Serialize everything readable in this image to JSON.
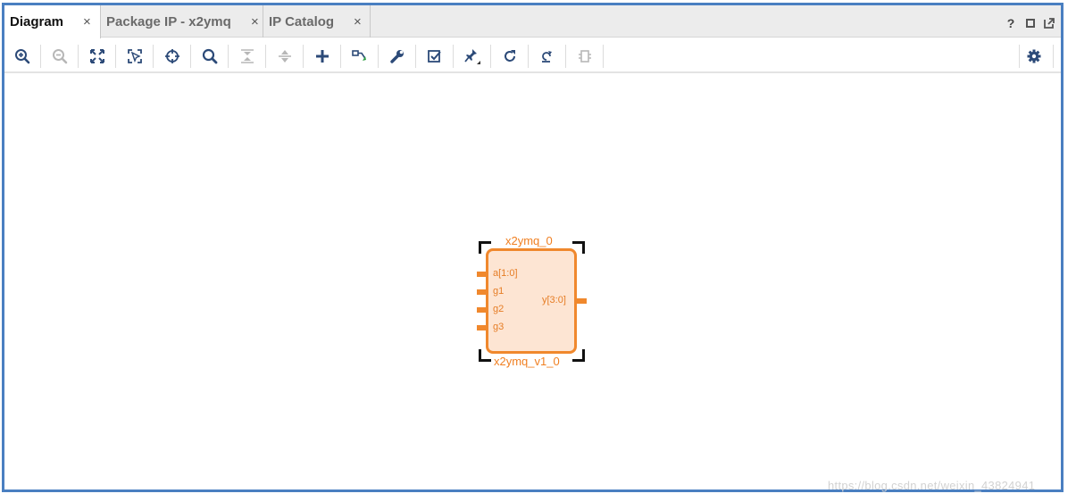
{
  "tabs": [
    {
      "label": "Diagram",
      "active": true,
      "close": "×"
    },
    {
      "label": "Package IP - x2ymq",
      "active": false,
      "close": "×"
    },
    {
      "label": "IP Catalog",
      "active": false,
      "close": "×"
    }
  ],
  "window_controls": {
    "help": "?"
  },
  "toolbar": [
    "zoom-in-icon",
    "zoom-out-icon",
    "zoom-fit-icon",
    "fit-selection-icon",
    "center-icon",
    "search-icon",
    "collapse-icon",
    "expand-icon",
    "add-ip-icon",
    "make-connection-icon",
    "wrench-icon",
    "validate-icon",
    "pin-icon",
    "refresh-icon",
    "regenerate-layout-icon",
    "hierarchy-icon",
    "settings-icon"
  ],
  "block": {
    "instance_name": "x2ymq_0",
    "module_name": "x2ymq_v1_0",
    "inputs": [
      "a[1:0]",
      "g1",
      "g2",
      "g3"
    ],
    "outputs": [
      "y[3:0]"
    ]
  },
  "colors": {
    "accent": "#f0882d",
    "block_fill": "#fde5d3",
    "frame_border": "#4a7fc1",
    "icon": "#2c4a78"
  },
  "watermark": "https://blog.csdn.net/weixin_43824941"
}
